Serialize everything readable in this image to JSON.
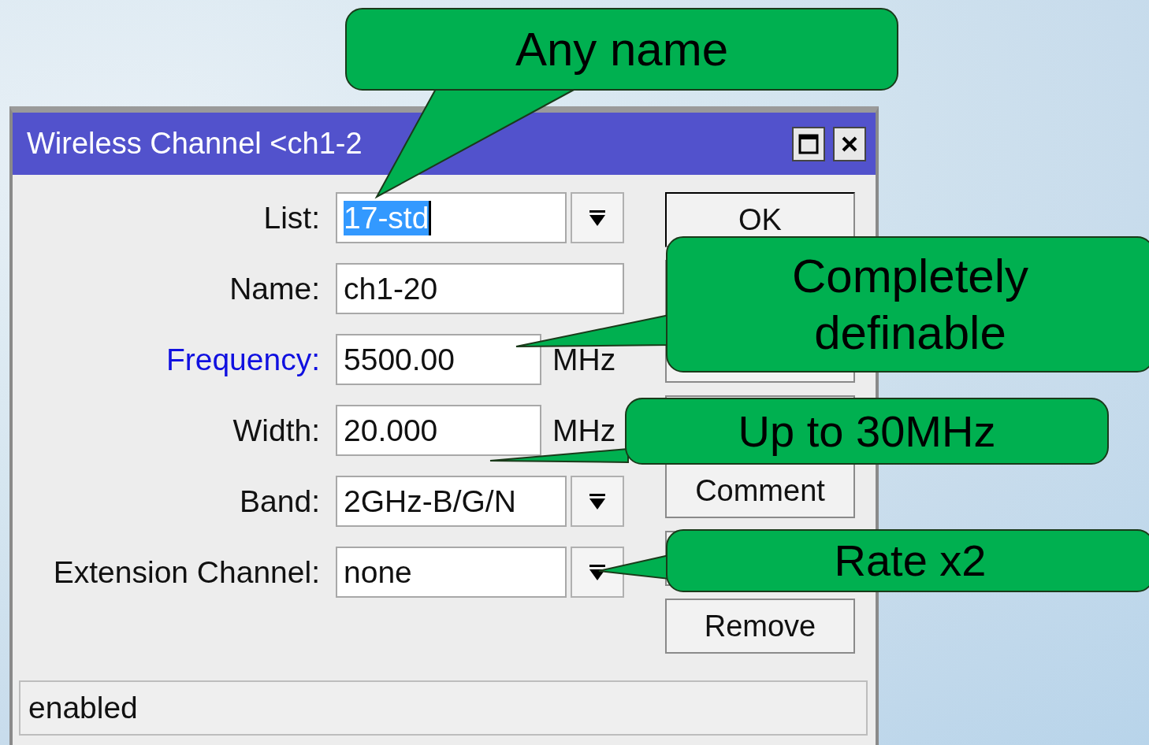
{
  "window": {
    "title": "Wireless Channel <ch1-2"
  },
  "fields": [
    {
      "label": "List:",
      "value": "17-std",
      "kind": "dropdown",
      "value_selected": true,
      "linked": false
    },
    {
      "label": "Name:",
      "value": "ch1-20",
      "kind": "text",
      "value_selected": false,
      "linked": false
    },
    {
      "label": "Frequency:",
      "value": "5500.00",
      "kind": "unit",
      "unit": "MHz",
      "value_selected": false,
      "linked": true
    },
    {
      "label": "Width:",
      "value": "20.000",
      "kind": "unit",
      "unit": "MHz",
      "value_selected": false,
      "linked": false
    },
    {
      "label": "Band:",
      "value": "2GHz-B/G/N",
      "kind": "dropdown",
      "value_selected": false,
      "linked": false
    },
    {
      "label": "Extension Channel:",
      "value": "none",
      "kind": "dropdown",
      "value_selected": false,
      "linked": false
    }
  ],
  "buttons": [
    {
      "label": "OK",
      "kind": "shown"
    },
    {
      "kind": "covered"
    },
    {
      "kind": "covered"
    },
    {
      "kind": "covered"
    },
    {
      "label": "Comment",
      "kind": "shown"
    },
    {
      "kind": "covered"
    },
    {
      "label": "Remove",
      "kind": "shown"
    }
  ],
  "status_bar": "enabled",
  "callouts": [
    {
      "text": "Any name"
    },
    {
      "text": "Completely definable"
    },
    {
      "text": "Up to 30MHz"
    },
    {
      "text": "Rate x2"
    }
  ]
}
